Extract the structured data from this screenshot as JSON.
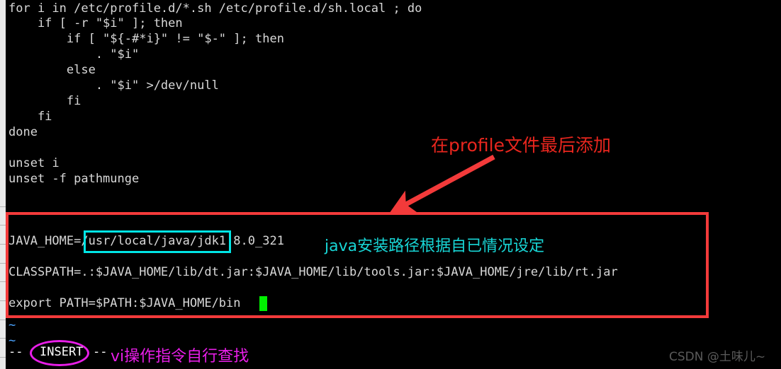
{
  "editor": {
    "name": "vi-editor",
    "background_color": "#000000",
    "text_color": "#d8d8d8",
    "tilde_color": "#4aa3ff",
    "cursor_color": "#00f000",
    "lines": [
      "for i in /etc/profile.d/*.sh /etc/profile.d/sh.local ; do",
      "    if [ -r \"$i\" ]; then",
      "        if [ \"${-#*i}\" != \"$-\" ]; then",
      "            . \"$i\"",
      "        else",
      "            . \"$i\" >/dev/null",
      "        fi",
      "    fi",
      "done",
      "",
      "unset i",
      "unset -f pathmunge",
      "",
      "JAVA_HOME=/usr/local/java/jdk1.8.0_321",
      "",
      "CLASSPATH=.:$JAVA_HOME/lib/dt.jar:$JAVA_HOME/lib/tools.jar:$JAVA_HOME/jre/lib/rt.jar",
      "",
      "export PATH=$PATH:$JAVA_HOME/bin"
    ],
    "java_home_prefix": "JAVA_HOME=",
    "java_home_value": "/usr/local/java/jdk1.8.0_321",
    "classpath_line": "CLASSPATH=.:$JAVA_HOME/lib/dt.jar:$JAVA_HOME/lib/tools.jar:$JAVA_HOME/jre/lib/rt.jar",
    "export_path_line": "export PATH=$PATH:$JAVA_HOME/bin",
    "empty_line_markers": [
      "~",
      "~"
    ]
  },
  "status_bar": {
    "prefix": "--",
    "mode": "INSERT",
    "suffix": "--"
  },
  "annotations": {
    "top_note": "在profile文件最后添加",
    "top_note_color": "#e8261e",
    "path_note": "java安装路径根据自已情况设定",
    "path_note_color": "#18d6d6",
    "insert_note": "vi操作指令自行查找",
    "insert_note_color": "#e81ee8",
    "arrow_color": "#f33a3a",
    "red_box_color": "#f33a3a",
    "cyan_box_color": "#00e5e5",
    "insert_ellipse_color": "#e81ee8"
  },
  "watermark": {
    "text": "CSDN @土味儿~",
    "color": "#5a5a5a"
  }
}
